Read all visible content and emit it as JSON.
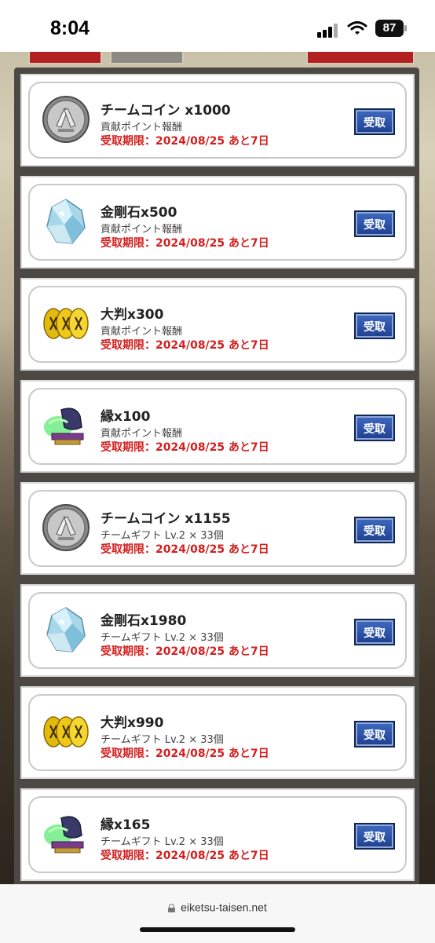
{
  "status_bar": {
    "time": "8:04",
    "battery": "87"
  },
  "colors": {
    "deadline": "#d41f1f",
    "button": "#2a4fa3",
    "frame": "#4c4944"
  },
  "rewards": [
    {
      "icon": "team-coin-icon",
      "name": "チームコイン x1000",
      "source": "貢献ポイント報酬",
      "deadline": "受取期限：2024/08/25 あと7日",
      "button": "受取"
    },
    {
      "icon": "diamond-crystal-icon",
      "name": "金剛石x500",
      "source": "貢献ポイント報酬",
      "deadline": "受取期限：2024/08/25 あと7日",
      "button": "受取"
    },
    {
      "icon": "oban-gold-icon",
      "name": "大判x300",
      "source": "貢献ポイント報酬",
      "deadline": "受取期限：2024/08/25 あと7日",
      "button": "受取"
    },
    {
      "icon": "en-horse-icon",
      "name": "縁x100",
      "source": "貢献ポイント報酬",
      "deadline": "受取期限：2024/08/25 あと7日",
      "button": "受取"
    },
    {
      "icon": "team-coin-icon",
      "name": "チームコイン x1155",
      "source": "チームギフト Lv.2 × 33個",
      "deadline": "受取期限：2024/08/25 あと7日",
      "button": "受取"
    },
    {
      "icon": "diamond-crystal-icon",
      "name": "金剛石x1980",
      "source": "チームギフト Lv.2 × 33個",
      "deadline": "受取期限：2024/08/25 あと7日",
      "button": "受取"
    },
    {
      "icon": "oban-gold-icon",
      "name": "大判x990",
      "source": "チームギフト Lv.2 × 33個",
      "deadline": "受取期限：2024/08/25 あと7日",
      "button": "受取"
    },
    {
      "icon": "en-horse-icon",
      "name": "縁x165",
      "source": "チームギフト Lv.2 × 33個",
      "deadline": "受取期限：2024/08/25 あと7日",
      "button": "受取"
    }
  ],
  "browser": {
    "url": "eiketsu-taisen.net"
  }
}
